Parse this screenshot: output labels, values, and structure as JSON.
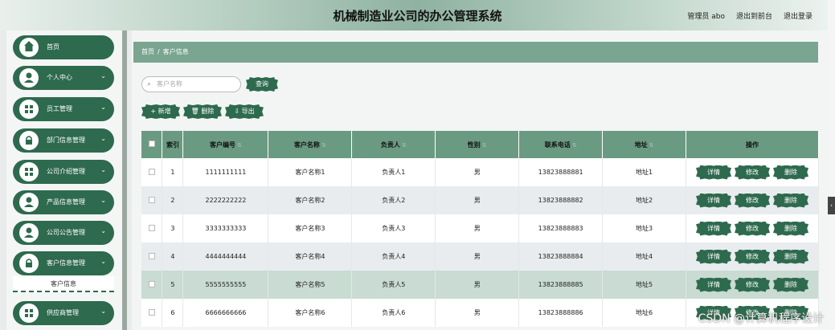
{
  "header": {
    "title": "机械制造业公司的办公管理系统",
    "admin": "管理员 abo",
    "front": "退出到前台",
    "logout": "退出登录"
  },
  "sidebar": {
    "items": [
      {
        "label": "首页",
        "icon": "home-icon",
        "chev": ""
      },
      {
        "label": "个人中心",
        "icon": "person-icon",
        "chev": "⌄"
      },
      {
        "label": "员工管理",
        "icon": "grid-icon",
        "chev": "⌄"
      },
      {
        "label": "部门信息管理",
        "icon": "lock-icon",
        "chev": "⌄"
      },
      {
        "label": "公司介绍管理",
        "icon": "grid-icon",
        "chev": "⌄"
      },
      {
        "label": "产品信息管理",
        "icon": "person-icon",
        "chev": "⌄"
      },
      {
        "label": "公司公告管理",
        "icon": "person-icon",
        "chev": "⌄"
      },
      {
        "label": "客户信息管理",
        "icon": "lock-icon",
        "chev": "⌄"
      },
      {
        "label": "供应商管理",
        "icon": "grid-icon",
        "chev": "⌄"
      }
    ],
    "submenu": "客户信息"
  },
  "breadcrumb": {
    "home": "首页",
    "sep": "/",
    "current": "客户信息"
  },
  "search": {
    "placeholder": "客户名称",
    "button": "查询"
  },
  "toolbar": {
    "add": "+ 新增",
    "delete": "🗑 删除",
    "export": "⇩ 导出"
  },
  "table": {
    "headers": {
      "index": "索引",
      "code": "客户编号",
      "name": "客户名称",
      "person": "负责人",
      "gender": "性别",
      "phone": "联系电话",
      "address": "地址",
      "ops": "操作"
    },
    "op_labels": {
      "detail": "详情",
      "edit": "修改",
      "delete": "删除"
    },
    "rows": [
      {
        "index": "1",
        "code": "1111111111",
        "name": "客户名称1",
        "person": "负责人1",
        "gender": "男",
        "phone": "13823888881",
        "address": "地址1"
      },
      {
        "index": "2",
        "code": "2222222222",
        "name": "客户名称2",
        "person": "负责人2",
        "gender": "男",
        "phone": "13823888882",
        "address": "地址2"
      },
      {
        "index": "3",
        "code": "3333333333",
        "name": "客户名称3",
        "person": "负责人3",
        "gender": "男",
        "phone": "13823888883",
        "address": "地址3"
      },
      {
        "index": "4",
        "code": "4444444444",
        "name": "客户名称4",
        "person": "负责人4",
        "gender": "男",
        "phone": "13823888884",
        "address": "地址4"
      },
      {
        "index": "5",
        "code": "5555555555",
        "name": "客户名称5",
        "person": "负责人5",
        "gender": "男",
        "phone": "13823888885",
        "address": "地址5"
      },
      {
        "index": "6",
        "code": "6666666666",
        "name": "客户名称6",
        "person": "负责人6",
        "gender": "男",
        "phone": "13823888886",
        "address": "地址6"
      }
    ]
  },
  "watermark": "CSDN @计算机程序设计",
  "colors": {
    "primary": "#2e6a4e",
    "header_row": "#6a9a82",
    "breadcrumb": "#7aa590"
  }
}
